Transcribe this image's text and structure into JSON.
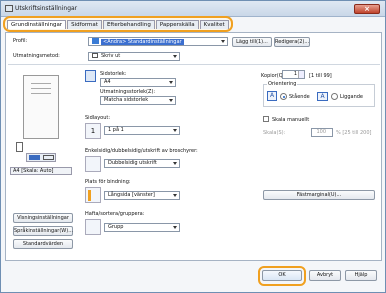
{
  "window": {
    "title": "Utskriftsinställningar",
    "close_glyph": "×"
  },
  "tabs": [
    {
      "label": "Grundinställningar",
      "active": true
    },
    {
      "label": "Sidformat",
      "active": false
    },
    {
      "label": "Efterbehandling",
      "active": false
    },
    {
      "label": "Papperskälla",
      "active": false
    },
    {
      "label": "Kvalitet",
      "active": false
    }
  ],
  "profile": {
    "label": "Profil:",
    "value": "<Ändra> Standardinställningar",
    "add_label": "Lägg till(1)...",
    "edit_label": "Redigera(2)..."
  },
  "output_method": {
    "label": "Utmatningsmetod:",
    "value": "Skriv ut"
  },
  "preview": {
    "caption": "A4 [Skala: Auto]"
  },
  "page_size": {
    "label": "Sidstorlek:",
    "value": "A4"
  },
  "output_size": {
    "label": "Utmatningsstorlek(Z):",
    "value": "Matcha sidstorlek"
  },
  "copies": {
    "label": "Kopior(Q):",
    "value": "1",
    "range": "[1 till 99]"
  },
  "orientation": {
    "label": "Orientering",
    "portrait": "Stående",
    "landscape": "Liggande",
    "portrait_icon": "A",
    "landscape_icon": "A",
    "selected": "portrait"
  },
  "layout": {
    "label": "Sidlayout:",
    "value": "1 på 1"
  },
  "manual_scale": {
    "label": "Skala manuellt",
    "scale_label": "Skala(S):",
    "scale_value": "100",
    "scale_range": "% [25 till 200]"
  },
  "duplex": {
    "label": "Enkelsidig/dubbelsidig/utskrift av broschyrer:",
    "value": "Dubbelsidig utskrift"
  },
  "binding": {
    "label": "Plats för bindning:",
    "value": "Långsida [vänster]",
    "margin_button": "Fästmarginal(U)..."
  },
  "collate": {
    "label": "Hafta/sortera/gruppera:",
    "value": "Grupp"
  },
  "left_buttons": [
    "Visningsinställningar",
    "Språkinställningar(W)...",
    "Standardvärden"
  ],
  "footer": {
    "ok": "OK",
    "cancel": "Avbryt",
    "help": "Hjälp"
  },
  "colors": {
    "highlight": "#f0a020",
    "selection_blue": "#cfe0f5"
  }
}
